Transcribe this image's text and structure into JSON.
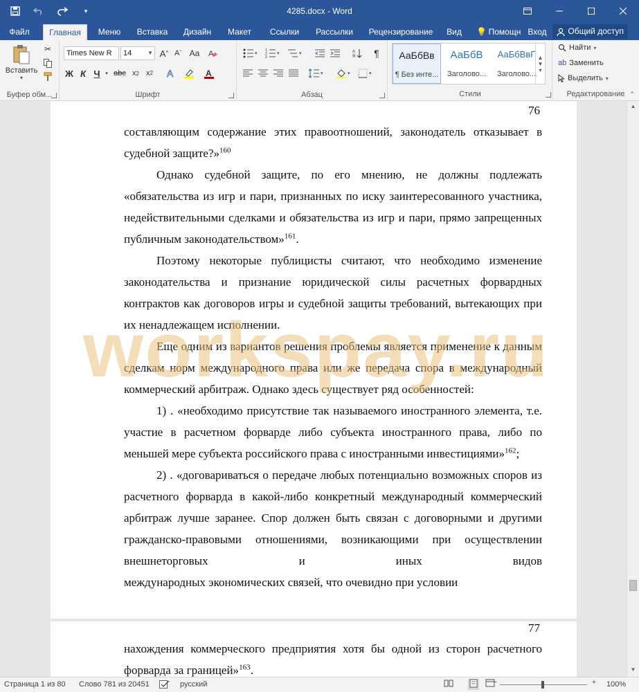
{
  "titlebar": {
    "title": "4285.docx - Word",
    "bg": "#2b579a"
  },
  "tabs": [
    {
      "label": "Файл"
    },
    {
      "label": "Главная"
    },
    {
      "label": "Меню"
    },
    {
      "label": "Вставка"
    },
    {
      "label": "Дизайн"
    },
    {
      "label": "Макет"
    },
    {
      "label": "Ссылки"
    },
    {
      "label": "Рассылки"
    },
    {
      "label": "Рецензирование"
    },
    {
      "label": "Вид"
    },
    {
      "label": "Помощн"
    },
    {
      "label": "Вход"
    }
  ],
  "share_label": "Общий доступ",
  "ribbon": {
    "clipboard": {
      "paste_label": "Вставить",
      "group_label": "Буфер обм..."
    },
    "font": {
      "font_name": "Times New R",
      "font_size": "14",
      "group_label": "Шрифт"
    },
    "paragraph": {
      "group_label": "Абзац"
    },
    "styles": {
      "group_label": "Стили",
      "items": [
        {
          "sample": "АаБбВв",
          "name": "¶ Без инте..."
        },
        {
          "sample": "АаБбВ",
          "name": "Заголово..."
        },
        {
          "sample": "АаБбВвГ",
          "name": "Заголово..."
        }
      ]
    },
    "editing": {
      "group_label": "Редактирование",
      "find": "Найти",
      "replace": "Заменить",
      "select": "Выделить"
    }
  },
  "document": {
    "page1": {
      "page_number": "76",
      "p1": "составляющим содержание этих правоотношений, законодатель отказывает в судебной защите?»",
      "p1_note": "160",
      "p2": "Однако судебной защите, по его мнению, не должны подлежать «обязательства из игр и пари, признанных по иску заинтересованного участника, недействительными сделками и обязательства из игр и пари, прямо запрещенных публичным законодательством»",
      "p2_note": "161",
      "p2_tail": ".",
      "p3": "Поэтому некоторые публицисты считают, что необходимо изменение законодательства и признание юридической силы расчетных форвардных контрактов как договоров игры и судебной защиты требований, вытекающих при их ненадлежащем исполнении.",
      "p4": "Еще одним из вариантов решения проблемы является применение к данным сделкам норм международного права или же передача спора в международный коммерческий арбитраж. Однако здесь существует ряд особенностей:",
      "p5": "1) . «необходимо присутствие так называемого иностранного элемента, т.е. участие в расчетном форварде либо субъекта иностранного права, либо по меньшей мере субъекта российского права с иностранными инвестициями»",
      "p5_note": "162",
      "p5_tail": ";",
      "p6": "2) . «договариваться о передаче любых потенциально возможных споров из расчетного форварда в какой-либо конкретный международный коммерческий арбитраж лучше заранее. Спор должен быть связан с договорными и другими гражданско-правовыми отношениями, возникающими при осуществлении внешнеторговых и иных видов",
      "p6_last": "международных экономических связей, что очевидно при условии"
    },
    "page2": {
      "page_number": "77",
      "p1": "нахождения коммерческого предприятия хотя бы одной из сторон расчетного форварда за границей»",
      "p1_note": "163",
      "p1_tail": "."
    },
    "watermark": "workspay.ru"
  },
  "statusbar": {
    "page": "Страница 1 из 80",
    "words": "Слово 781 из 20451",
    "language": "русский",
    "zoom": "100%"
  }
}
